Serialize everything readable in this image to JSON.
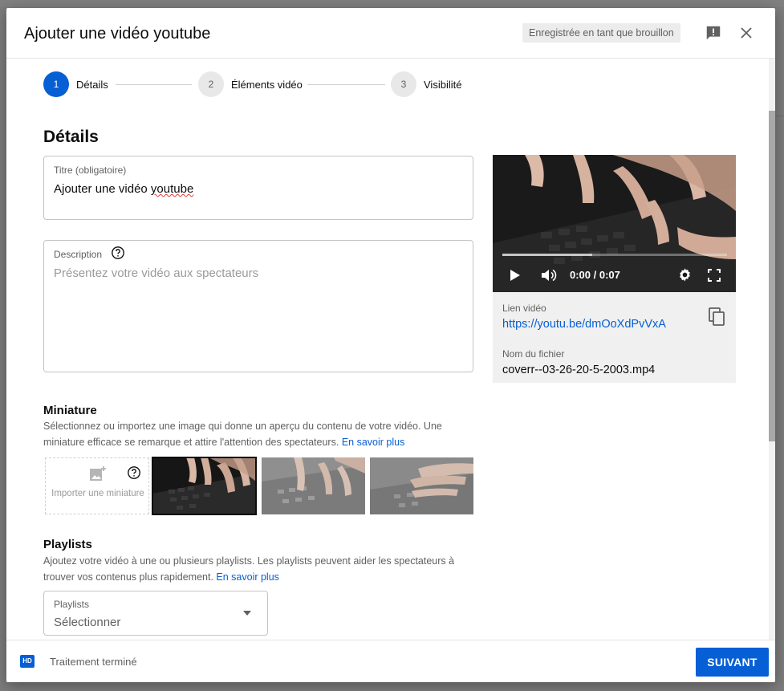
{
  "dialog": {
    "title": "Ajouter une vidéo youtube",
    "draft_badge": "Enregistrée en tant que brouillon"
  },
  "stepper": {
    "steps": [
      {
        "number": "1",
        "label": "Détails",
        "state": "active"
      },
      {
        "number": "2",
        "label": "Éléments vidéo",
        "state": "inactive"
      },
      {
        "number": "3",
        "label": "Visibilité",
        "state": "inactive"
      }
    ]
  },
  "details": {
    "heading": "Détails",
    "title_field": {
      "label": "Titre (obligatoire)",
      "value_prefix": "Ajouter une vidéo ",
      "value_flagged": "youtube"
    },
    "description_field": {
      "label": "Description",
      "placeholder": "Présentez votre vidéo aux spectateurs"
    }
  },
  "thumbnail": {
    "heading": "Miniature",
    "description": "Sélectionnez ou importez une image qui donne un aperçu du contenu de votre vidéo. Une miniature efficace se remarque et attire l'attention des spectateurs.",
    "learn_more": "En savoir plus",
    "upload_label": "Importer une miniature",
    "selected_index": 1
  },
  "playlists": {
    "heading": "Playlists",
    "description": "Ajoutez votre vidéo à une ou plusieurs playlists. Les playlists peuvent aider les spectateurs à trouver vos contenus plus rapidement.",
    "learn_more": "En savoir plus",
    "select_label": "Playlists",
    "select_value": "Sélectionner"
  },
  "video": {
    "time": "0:00 / 0:07",
    "link_label": "Lien vidéo",
    "link": "https://youtu.be/dmOoXdPvVxA",
    "filename_label": "Nom du fichier",
    "filename": "coverr--03-26-20-5-2003.mp4",
    "buffered_fraction": 0.4
  },
  "footer": {
    "hd_badge": "HD",
    "status": "Traitement terminé",
    "next_label": "SUIVANT"
  },
  "colors": {
    "accent": "#065fd4",
    "text_primary": "#0d0d0d",
    "text_secondary": "#606060"
  }
}
